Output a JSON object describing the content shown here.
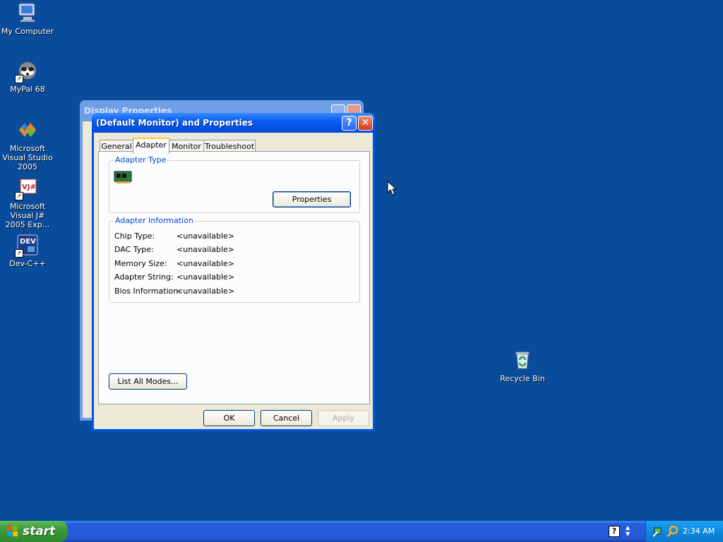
{
  "desktop": {
    "icons": [
      {
        "label": "My Computer"
      },
      {
        "label": "MyPal 68"
      },
      {
        "label": "Microsoft Visual Studio 2005"
      },
      {
        "label": "Microsoft Visual J# 2005 Exp..."
      },
      {
        "label": "Dev-C++"
      },
      {
        "label": "Recycle Bin"
      }
    ]
  },
  "back_window": {
    "title": "Display Properties"
  },
  "dialog": {
    "title": "(Default Monitor) and  Properties",
    "help_glyph": "?",
    "close_glyph": "✕",
    "tabs": [
      {
        "label": "General",
        "active": false
      },
      {
        "label": "Adapter",
        "active": true
      },
      {
        "label": "Monitor",
        "active": false
      },
      {
        "label": "Troubleshoot",
        "active": false
      }
    ],
    "adapter_type": {
      "group_title": "Adapter Type",
      "properties_button": "Properties"
    },
    "adapter_info": {
      "group_title": "Adapter Information",
      "rows": [
        {
          "label": "Chip Type:",
          "value": "<unavailable>"
        },
        {
          "label": "DAC Type:",
          "value": "<unavailable>"
        },
        {
          "label": "Memory Size:",
          "value": "<unavailable>"
        },
        {
          "label": "Adapter String:",
          "value": "<unavailable>"
        },
        {
          "label": "Bios Information:",
          "value": "<unavailable>"
        }
      ]
    },
    "list_modes_button": "List All Modes...",
    "ok_button": "OK",
    "cancel_button": "Cancel",
    "apply_button": "Apply"
  },
  "taskbar": {
    "start_label": "start",
    "clock": "2:34 AM"
  },
  "colors": {
    "desktop": "#0a4c9c",
    "titlebar": "#0054e3",
    "dialog_face": "#ece9d8",
    "group_title": "#0046d5",
    "tab_highlight": "#ffc83c"
  }
}
